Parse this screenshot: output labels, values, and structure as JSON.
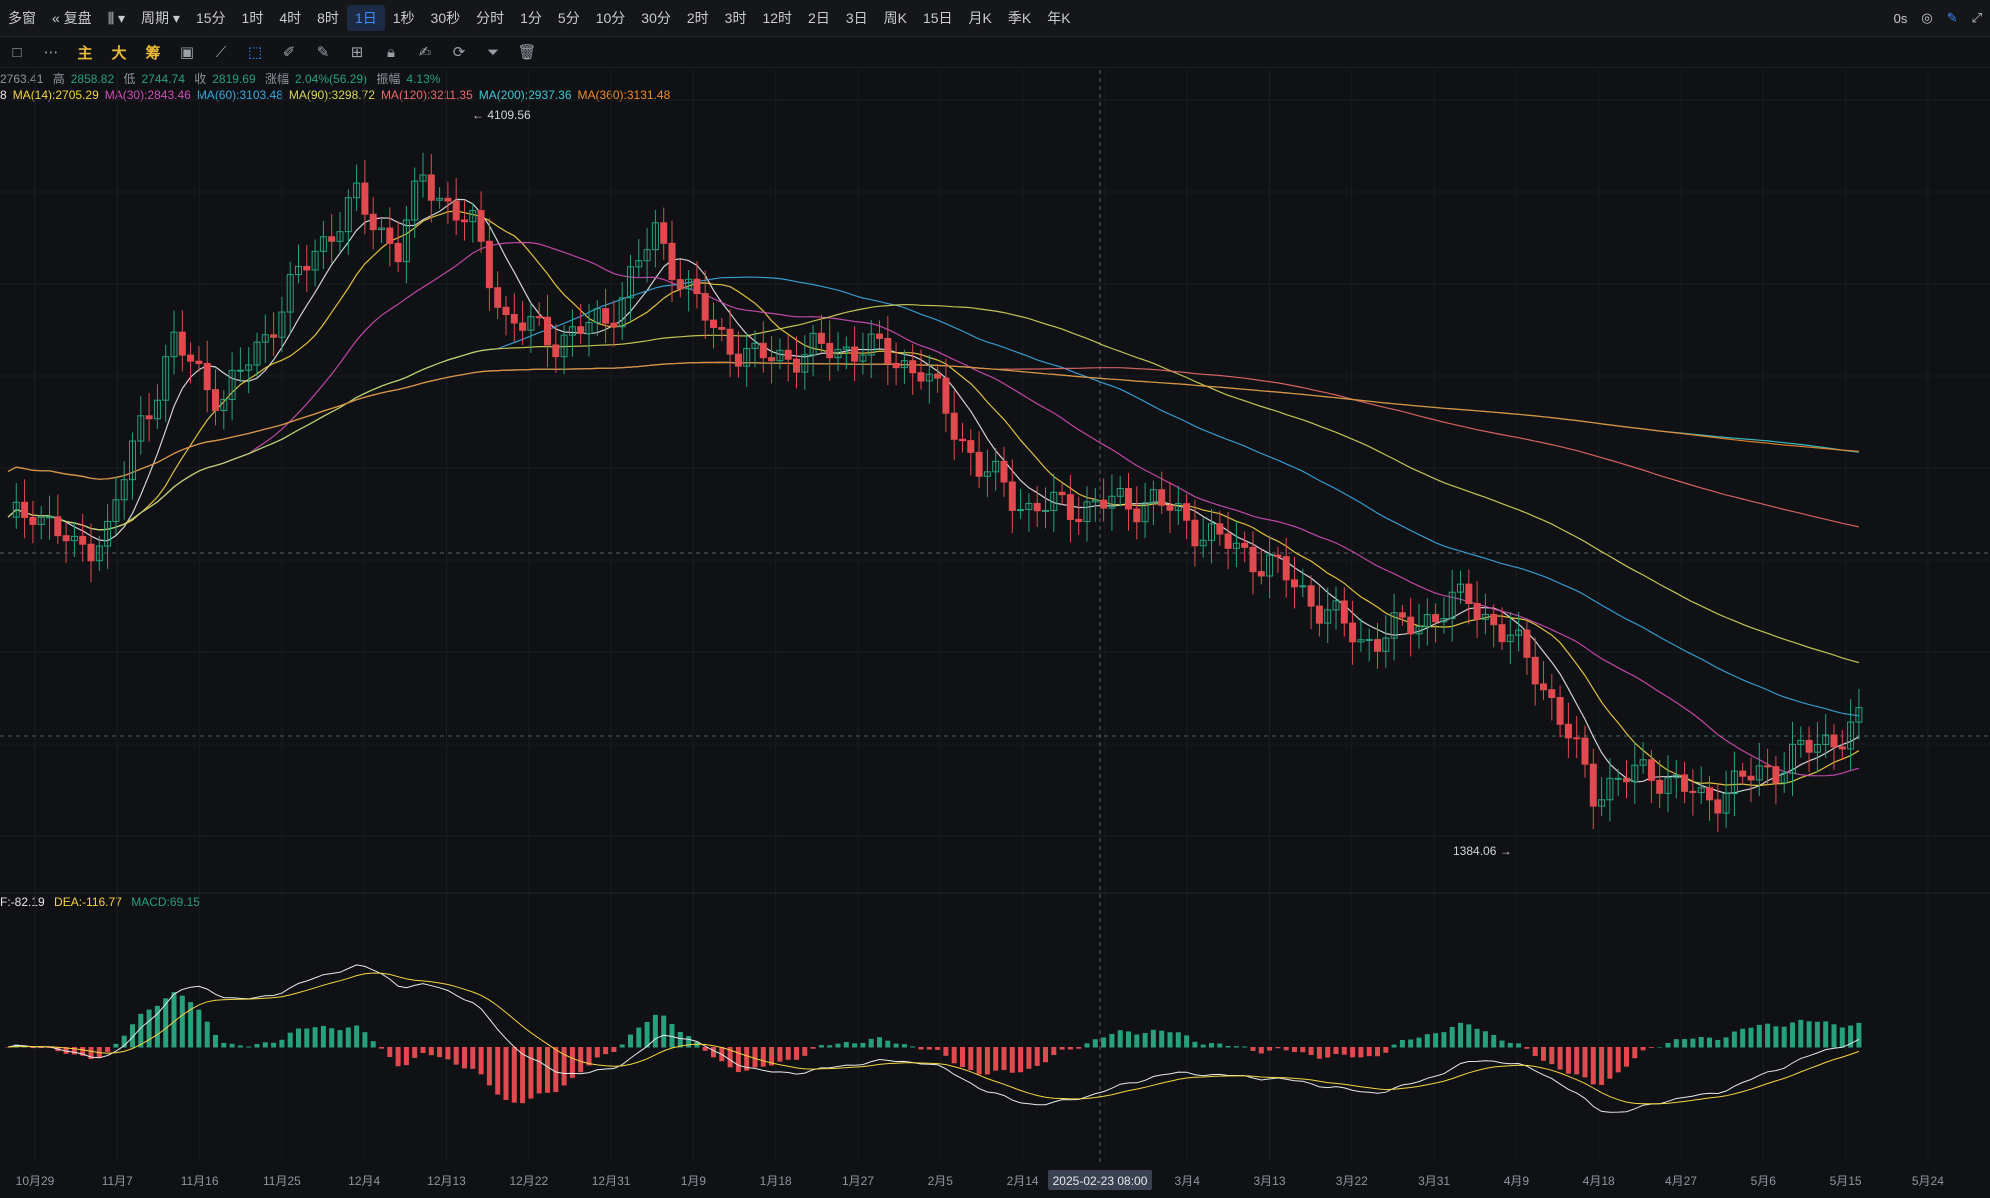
{
  "toolbar": {
    "left_items": [
      "多窗",
      "复盘",
      "周期"
    ],
    "periods": [
      "15分",
      "1时",
      "4时",
      "8时",
      "1日",
      "1秒",
      "30秒",
      "分时",
      "1分",
      "5分",
      "10分",
      "30分",
      "2时",
      "3时",
      "12时",
      "2日",
      "3日",
      "周K",
      "15日",
      "月K",
      "季K",
      "年K"
    ],
    "active_period": "1日",
    "right_time": "0s"
  },
  "drawbar": {
    "zhu": "主",
    "da": "大",
    "chou": "筹"
  },
  "info": {
    "open": "2763.41",
    "high_label": "高",
    "high": "2858.82",
    "low_label": "低",
    "low": "2744.74",
    "close_label": "收",
    "close": "2819.69",
    "change_label": "涨幅",
    "change": "2.04%(56.29)",
    "amp_label": "振幅",
    "amp": "4.13%"
  },
  "ma": [
    {
      "label": "8",
      "color": "#e8e8e8"
    },
    {
      "label": "MA(14):2705.29",
      "color": "#f5d442"
    },
    {
      "label": "MA(30):2843.46",
      "color": "#d04fb5"
    },
    {
      "label": "MA(60):3103.48",
      "color": "#3aa8e0"
    },
    {
      "label": "MA(90):3298.72",
      "color": "#d6d65a"
    },
    {
      "label": "MA(120):3211.35",
      "color": "#e86a6a"
    },
    {
      "label": "MA(200):2937.36",
      "color": "#3ec8d0"
    },
    {
      "label": "MA(360):3131.48",
      "color": "#f08a2a"
    }
  ],
  "macd": {
    "dif": "F:-82.19",
    "dea": "DEA:-116.77",
    "macd": "MACD:69.15"
  },
  "annotations": {
    "high": "4109.56",
    "low": "1384.06",
    "cursor_date": "2025-02-23 08:00"
  },
  "chart_data": {
    "type": "candlestick",
    "x_ticks": [
      "10月29",
      "11月7",
      "11月16",
      "11月25",
      "12月4",
      "12月13",
      "12月22",
      "12月31",
      "1月9",
      "1月18",
      "1月27",
      "2月5",
      "2月14",
      "2月23",
      "3月4",
      "3月13",
      "3月22",
      "3月31",
      "4月9",
      "4月18",
      "4月27",
      "5月6",
      "5月15",
      "5月24"
    ],
    "ylim": [
      1200,
      4400
    ],
    "up_color": "#26a17b",
    "down_color": "#e04a4f",
    "high": 4109.56,
    "low": 1384.06
  }
}
